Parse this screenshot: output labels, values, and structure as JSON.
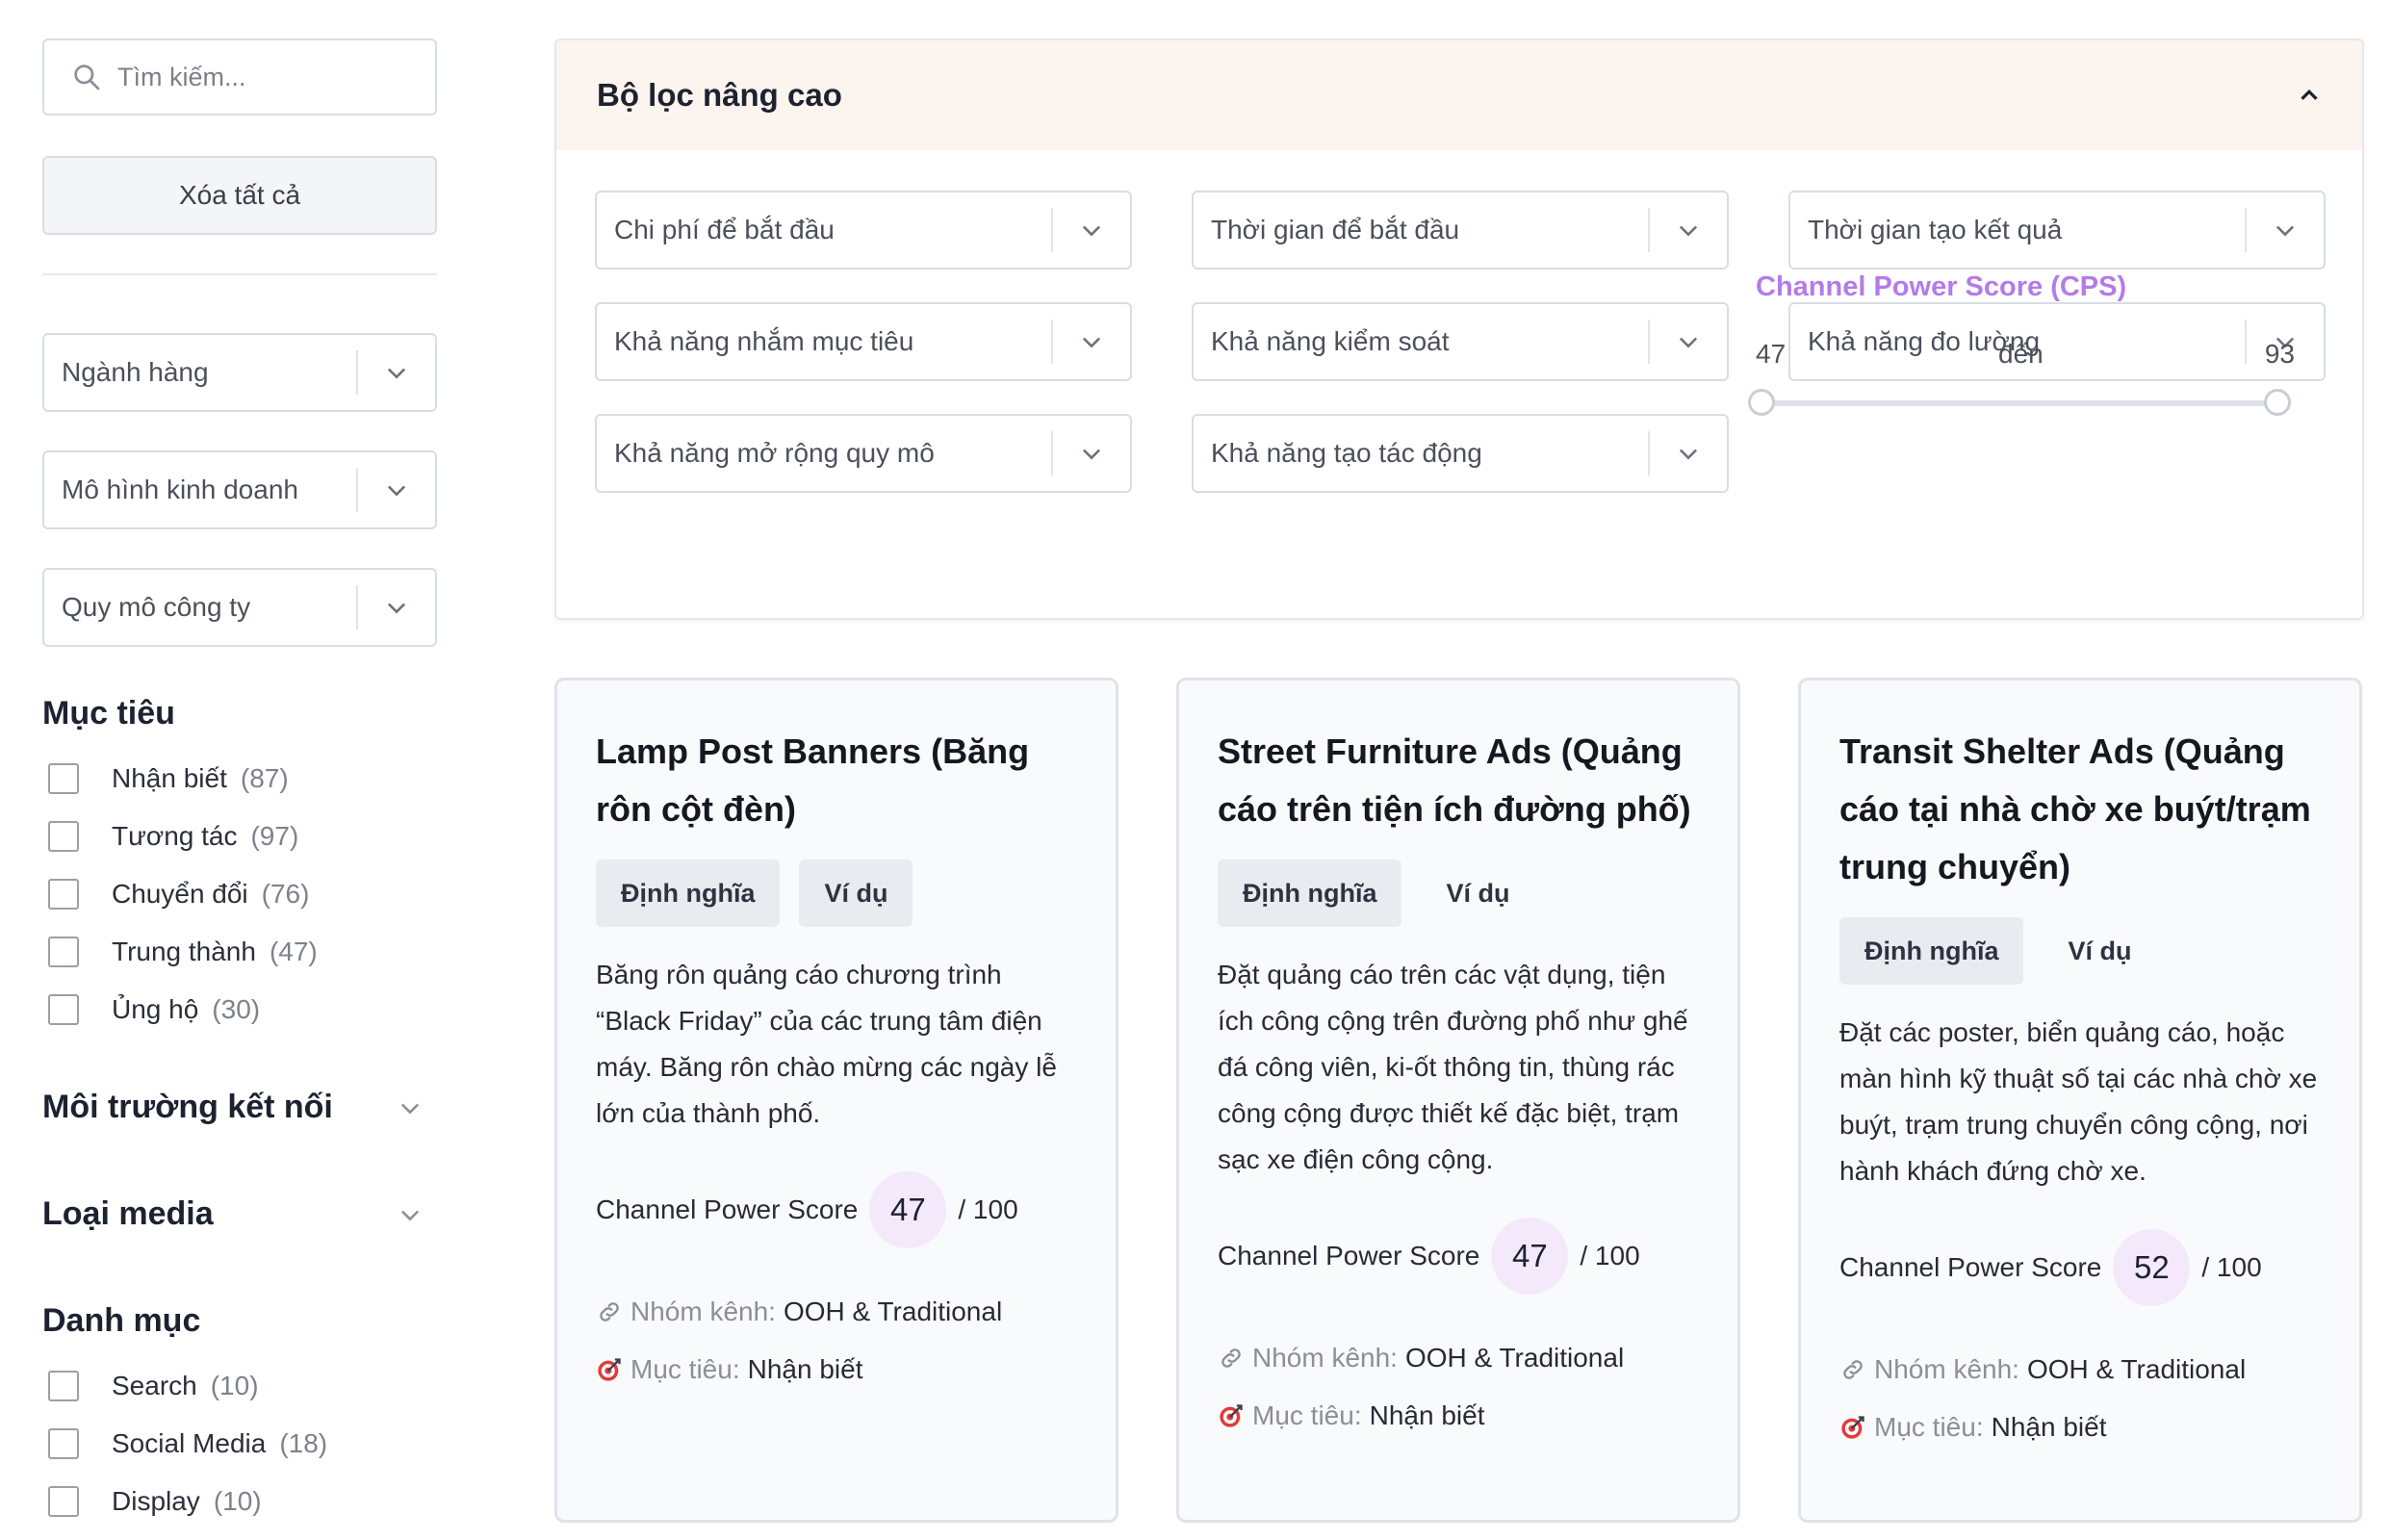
{
  "sidebar": {
    "search_placeholder": "Tìm kiếm...",
    "clear_all": "Xóa tất cả",
    "selects": [
      "Ngành hàng",
      "Mô hình kinh doanh",
      "Quy mô công ty"
    ],
    "goals": {
      "title": "Mục tiêu",
      "items": [
        {
          "label": "Nhận biết",
          "count": "(87)"
        },
        {
          "label": "Tương tác",
          "count": "(97)"
        },
        {
          "label": "Chuyển đổi",
          "count": "(76)"
        },
        {
          "label": "Trung thành",
          "count": "(47)"
        },
        {
          "label": "Ủng hộ",
          "count": "(30)"
        }
      ]
    },
    "env_title": "Môi trường kết nối",
    "media_title": "Loại media",
    "categories": {
      "title": "Danh mục",
      "items": [
        {
          "label": "Search",
          "count": "(10)"
        },
        {
          "label": "Social Media",
          "count": "(18)"
        },
        {
          "label": "Display",
          "count": "(10)"
        }
      ]
    }
  },
  "filter": {
    "title": "Bộ lọc nâng cao",
    "selects": [
      "Chi phí để bắt đầu",
      "Thời gian để bắt đầu",
      "Thời gian tạo kết quả",
      "Khả năng nhắm mục tiêu",
      "Khả năng kiểm soát",
      "Khả năng đo lường",
      "Khả năng mở rộng quy mô",
      "Khả năng tạo tác động"
    ],
    "cps_label": "Channel Power Score (CPS)",
    "cps_min": "47",
    "cps_to": "đến",
    "cps_max": "93",
    "accent": "#b47be8"
  },
  "cards": [
    {
      "title": "Lamp Post Banners (Băng rôn cột đèn)",
      "tab_definition": "Định nghĩa",
      "tab_example": "Ví dụ",
      "description": "Băng rôn quảng cáo chương trình “Black Friday” của các trung tâm điện máy. Băng rôn chào mừng các ngày lễ lớn của thành phố.",
      "score_label": "Channel Power Score",
      "score": "47",
      "score_max": "/ 100",
      "group_label": "Nhóm kênh:",
      "group": "OOH & Traditional",
      "goal_label": "Mục tiêu:",
      "goal": "Nhận biết"
    },
    {
      "title": "Street Furniture Ads (Quảng cáo trên tiện ích đường phố)",
      "tab_definition": "Định nghĩa",
      "tab_example": "Ví dụ",
      "description": "Đặt quảng cáo trên các vật dụng, tiện ích công cộng trên đường phố như ghế đá công viên, ki-ốt thông tin, thùng rác công cộng được thiết kế đặc biệt, trạm sạc xe điện công cộng.",
      "score_label": "Channel Power Score",
      "score": "47",
      "score_max": "/ 100",
      "group_label": "Nhóm kênh:",
      "group": "OOH & Traditional",
      "goal_label": "Mục tiêu:",
      "goal": "Nhận biết"
    },
    {
      "title": "Transit Shelter Ads (Quảng cáo tại nhà chờ xe buýt/trạm trung chuyển)",
      "tab_definition": "Định nghĩa",
      "tab_example": "Ví dụ",
      "description": "Đặt các poster, biển quảng cáo, hoặc màn hình kỹ thuật số tại các nhà chờ xe buýt, trạm trung chuyển công cộng, nơi hành khách đứng chờ xe.",
      "score_label": "Channel Power Score",
      "score": "52",
      "score_max": "/ 100",
      "group_label": "Nhóm kênh:",
      "group": "OOH & Traditional",
      "goal_label": "Mục tiêu:",
      "goal": "Nhận biết"
    }
  ]
}
